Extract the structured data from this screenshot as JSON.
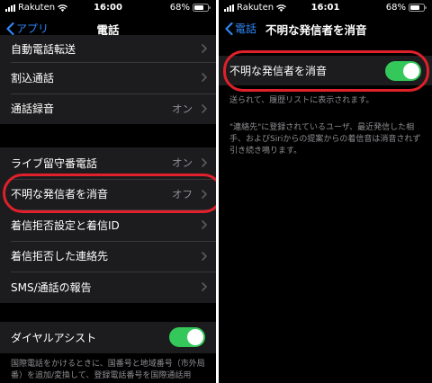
{
  "left": {
    "status": {
      "carrier": "Rakuten",
      "time": "16:00",
      "battery": "68%"
    },
    "nav": {
      "back_label": "アプリ",
      "title": "電話"
    },
    "group1": [
      {
        "label": "自動電話転送",
        "value": ""
      },
      {
        "label": "割込通話",
        "value": ""
      },
      {
        "label": "通話録音",
        "value": "オン"
      }
    ],
    "group2": [
      {
        "label": "ライブ留守番電話",
        "value": "オン"
      },
      {
        "label": "不明な発信者を消音",
        "value": "オフ"
      },
      {
        "label": "着信拒否設定と着信ID",
        "value": ""
      },
      {
        "label": "着信拒否した連絡先",
        "value": ""
      },
      {
        "label": "SMS/通話の報告",
        "value": ""
      }
    ],
    "dial_assist": {
      "label": "ダイヤルアシスト",
      "on": true
    },
    "footnote": "国際電話をかけるときに、国番号と地域番号（市外局番）を追加/変換して、登録電話番号を国際通話用"
  },
  "right": {
    "status": {
      "carrier": "Rakuten",
      "time": "16:01",
      "battery": "68%"
    },
    "nav": {
      "back_label": "電話",
      "title": "不明な発信者を消音"
    },
    "toggle_row": {
      "label": "不明な発信者を消音",
      "on": true
    },
    "footnote1": "送られて、履歴リストに表示されます。",
    "footnote2": "\"連絡先\"に登録されているユーザ、最近発信した相手、およびSiriからの提案からの着信音は消音されず引き続き鳴ります。"
  },
  "colors": {
    "accent": "#2f87f7",
    "toggle_on": "#34c759",
    "highlight": "#e0202a",
    "cell": "#1c1c1e"
  }
}
